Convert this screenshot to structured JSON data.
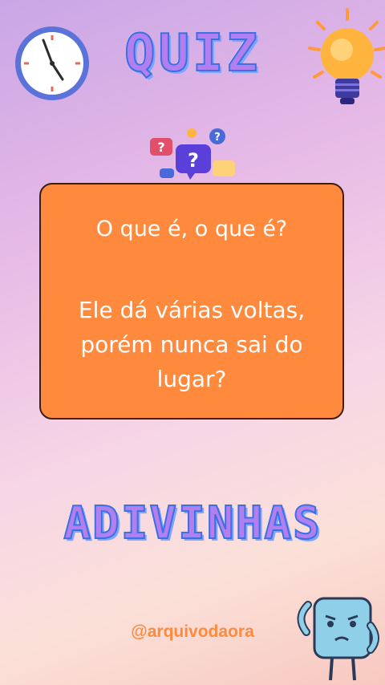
{
  "header": {
    "title": "QUIZ"
  },
  "card": {
    "question_intro": "O que é, o que é?",
    "question_text": "Ele dá várias voltas, porém nunca sai do lugar?"
  },
  "footer": {
    "title": "ADIVINHAS",
    "handle": "@arquivodaora"
  },
  "icons": {
    "clock": "clock-icon",
    "bulb": "lightbulb-icon",
    "bubbles": "speech-bubbles-icon",
    "mascot": "cube-mascot-icon"
  },
  "colors": {
    "card": "#ff8a3d",
    "title_fill": "#b27ff0",
    "title_stroke": "#3d6fe0",
    "handle": "#ff8a3d"
  }
}
